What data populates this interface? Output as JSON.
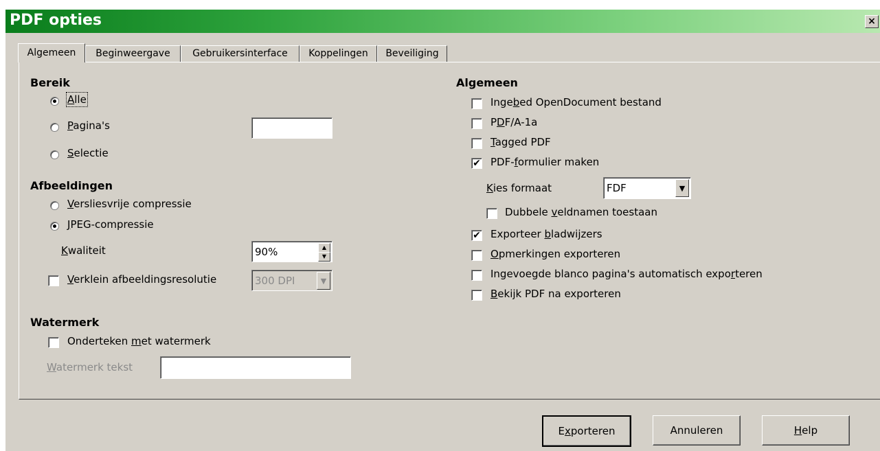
{
  "window": {
    "title": "PDF opties",
    "close_glyph": "×"
  },
  "tabs": [
    {
      "label": "Algemeen",
      "active": true
    },
    {
      "label": "Beginweergave",
      "active": false
    },
    {
      "label": "Gebruikersinterface",
      "active": false
    },
    {
      "label": "Koppelingen",
      "active": false
    },
    {
      "label": "Beveiliging",
      "active": false
    }
  ],
  "range": {
    "heading": "Bereik",
    "all": {
      "pre": "",
      "key": "A",
      "post": "lle",
      "selected": true
    },
    "pages": {
      "pre": "",
      "key": "P",
      "post": "agina's",
      "selected": false,
      "value": ""
    },
    "selection": {
      "pre": "",
      "key": "S",
      "post": "electie",
      "selected": false
    }
  },
  "images": {
    "heading": "Afbeeldingen",
    "lossless": {
      "pre": "",
      "key": "V",
      "post": "ersliesvrije compressie",
      "selected": false
    },
    "jpeg": {
      "pre": "",
      "key": "J",
      "post": "PEG-compressie",
      "selected": true
    },
    "quality": {
      "pre": "",
      "key": "K",
      "post": "waliteit",
      "value": "90%"
    },
    "reduce": {
      "pre": "",
      "key": "V",
      "post": "erklein afbeeldingsresolutie",
      "checked": false,
      "value": "300 DPI"
    }
  },
  "watermark": {
    "heading": "Watermerk",
    "sign": {
      "pre": "Onderteken ",
      "key": "m",
      "post": "et watermerk",
      "checked": false
    },
    "text_label": {
      "pre": "",
      "key": "W",
      "post": "atermerk tekst"
    },
    "text_value": ""
  },
  "general": {
    "heading": "Algemeen",
    "embed": {
      "pre": "Inge",
      "key": "b",
      "post": "ed OpenDocument bestand",
      "checked": false
    },
    "pdfa": {
      "pre": "P",
      "key": "D",
      "post": "F/A-1a",
      "checked": false
    },
    "tagged": {
      "pre": "",
      "key": "T",
      "post": "agged PDF",
      "checked": false
    },
    "form": {
      "pre": "PDF-",
      "key": "f",
      "post": "ormulier maken",
      "checked": true
    },
    "format_label": {
      "pre": "",
      "key": "K",
      "post": "ies formaat"
    },
    "format_value": "FDF",
    "duplicate": {
      "pre": "Dubbele ",
      "key": "v",
      "post": "eldnamen toestaan",
      "checked": false
    },
    "bookmarks": {
      "pre": "Exporteer ",
      "key": "b",
      "post": "ladwijzers",
      "checked": true
    },
    "notes": {
      "pre": "",
      "key": "O",
      "post": "pmerkingen exporteren",
      "checked": false
    },
    "blank": {
      "pre": "Ingevoegde blanco pagina's automatisch expo",
      "key": "r",
      "post": "teren",
      "checked": false
    },
    "view": {
      "pre": "",
      "key": "B",
      "post": "ekijk PDF na exporteren",
      "checked": false
    }
  },
  "buttons": {
    "export": {
      "pre": "E",
      "key": "x",
      "post": "porteren"
    },
    "cancel": {
      "pre": "Annuleren",
      "key": "",
      "post": ""
    },
    "help": {
      "pre": "",
      "key": "H",
      "post": "elp"
    }
  },
  "glyphs": {
    "check": "✔",
    "up": "▲",
    "down": "▼"
  },
  "icons": [
    "close-icon",
    "radio-icon",
    "checkbox-icon",
    "spinner-icon",
    "dropdown-arrow-icon"
  ]
}
